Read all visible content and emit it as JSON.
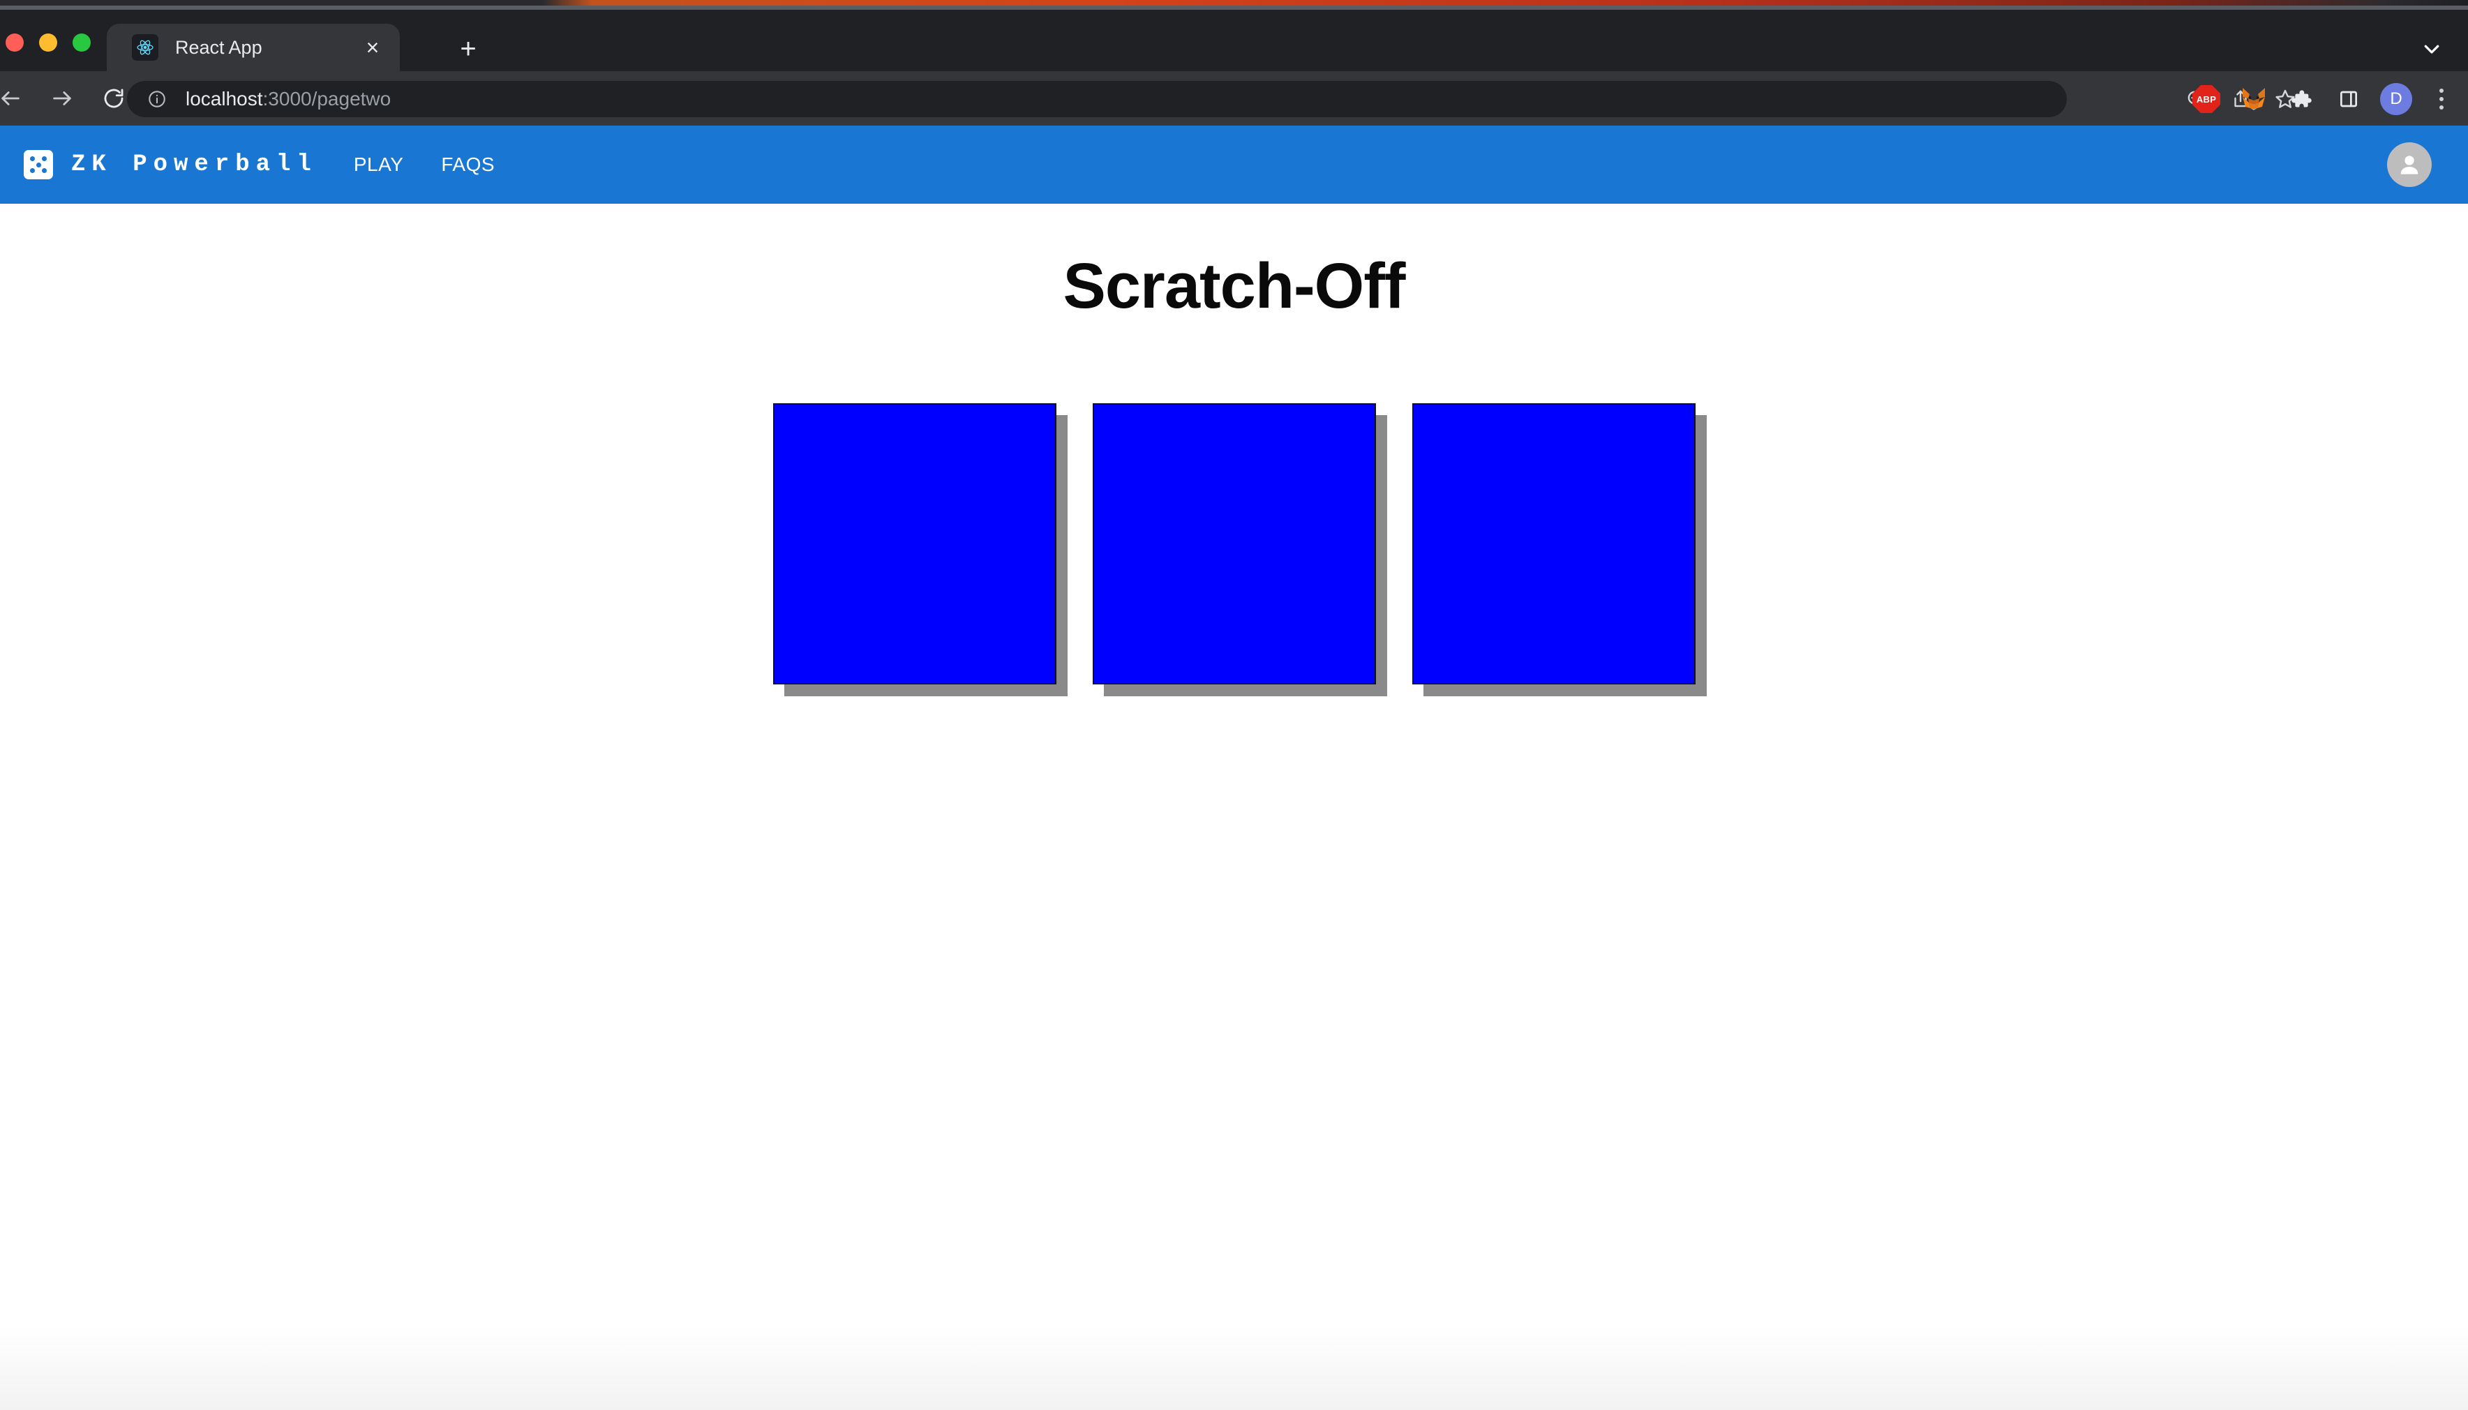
{
  "browser": {
    "window_controls": [
      "close",
      "minimize",
      "maximize"
    ],
    "tab": {
      "title": "React App",
      "favicon": "react-logo-icon",
      "close_label": "×"
    },
    "new_tab_label": "+",
    "tab_list_icon": "chevron-down-icon",
    "nav": {
      "back_icon": "arrow-left-icon",
      "forward_icon": "arrow-right-icon",
      "reload_icon": "reload-icon"
    },
    "omnibox": {
      "site_info_icon": "info-circle-icon",
      "host": "localhost",
      "path": ":3000/pagetwo",
      "full_url": "localhost:3000/pagetwo"
    },
    "omnibox_actions": [
      {
        "name": "zoom-out-icon",
        "label": "Zoom out"
      },
      {
        "name": "share-icon",
        "label": "Share this page"
      },
      {
        "name": "bookmark-star-icon",
        "label": "Bookmark this tab"
      }
    ],
    "extensions": [
      {
        "name": "adblock-plus-icon",
        "label": "ABP"
      },
      {
        "name": "metamask-fox-icon",
        "label": "MetaMask"
      },
      {
        "name": "extensions-puzzle-icon",
        "label": "Extensions"
      },
      {
        "name": "side-panel-icon",
        "label": "Side panel"
      }
    ],
    "profile": {
      "initial": "D",
      "color": "#6d7ce0"
    },
    "menu_icon": "three-dot-menu-icon"
  },
  "app": {
    "brand": {
      "logo_icon": "dice-five-icon",
      "name": "ZK Powerball"
    },
    "nav_links": [
      {
        "label": "PLAY"
      },
      {
        "label": "FAQS"
      }
    ],
    "account_avatar_icon": "person-avatar-icon",
    "accent_color": "#1976d2"
  },
  "main": {
    "title": "Scratch-Off",
    "cards": [
      {
        "id": "scratch-card-1",
        "color": "#0000ff",
        "state": "unscratched"
      },
      {
        "id": "scratch-card-2",
        "color": "#0000ff",
        "state": "unscratched"
      },
      {
        "id": "scratch-card-3",
        "color": "#0000ff",
        "state": "unscratched"
      }
    ],
    "card_shadow_color": "#8a8a8a"
  }
}
